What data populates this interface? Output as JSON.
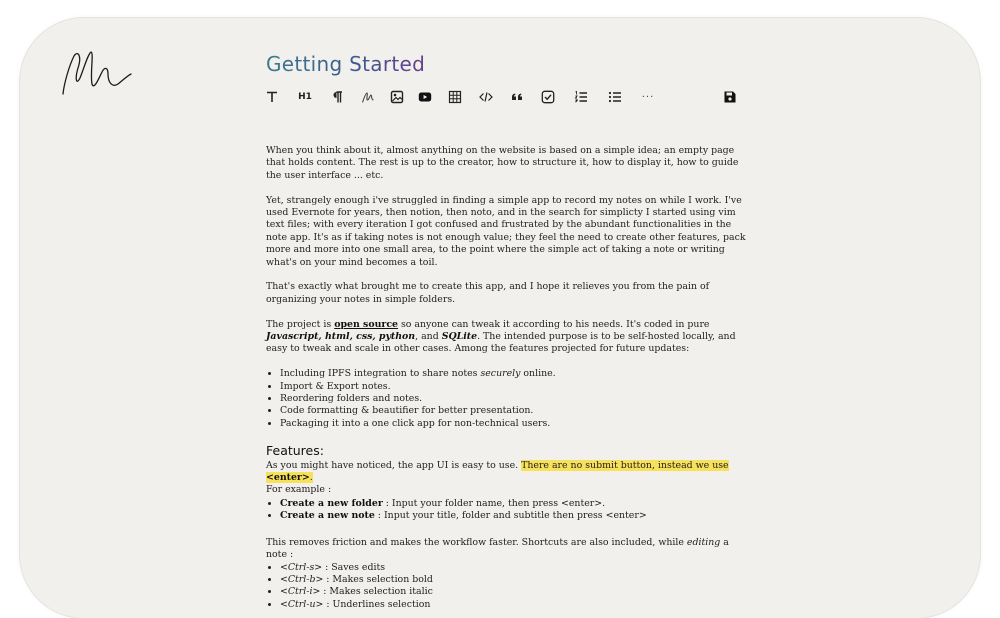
{
  "page": {
    "title": "Getting Started"
  },
  "toolbar": {
    "items": [
      {
        "name": "text-icon",
        "tooltip": ""
      },
      {
        "name": "heading-icon",
        "tooltip": ""
      },
      {
        "name": "paragraph-icon",
        "tooltip": ""
      },
      {
        "name": "signature-icon",
        "tooltip": ""
      },
      {
        "name": "image-icon",
        "tooltip": ""
      },
      {
        "name": "youtube-icon",
        "tooltip": ""
      },
      {
        "name": "table-icon",
        "tooltip": ""
      },
      {
        "name": "code-icon",
        "tooltip": ""
      },
      {
        "name": "quote-icon",
        "tooltip": ""
      },
      {
        "name": "checkbox-icon",
        "tooltip": ""
      },
      {
        "name": "ordered-list-icon",
        "tooltip": ""
      },
      {
        "name": "unordered-list-icon",
        "tooltip": ""
      },
      {
        "name": "more-icon",
        "tooltip": ""
      },
      {
        "name": "save-icon",
        "tooltip": ""
      }
    ],
    "heading_label": "H1",
    "more_label": "···"
  },
  "content": {
    "p1": "When you think about it, almost anything on the website is based on a simple idea; an empty page that holds content. The rest is up to the creator, how to structure it, how to display it, how to guide the user interface ... etc.",
    "p2": "Yet, strangely enough i've struggled in finding a simple app to record my notes on while I work. I've used Evernote for years, then notion, then noto, and in the search for simplicty I started using vim text files; with every iteration I got confused and frustrated by the abundant functionalities in the note app. It's as if taking notes is not enough value; they feel the need to create other features, pack more and more into one small area, to the point where the simple act of taking a note or writing what's on your mind becomes a toil.",
    "p3": "That's exactly what brought me to create this app, and I hope it relieves you from the pain of organizing your notes in simple folders.",
    "p4": {
      "t1": "The project is ",
      "link": "open source",
      "t2": " so anyone can tweak it according to his needs. It's coded in pure ",
      "js": "Javascript",
      "c1": ", ",
      "html": "html",
      "c2": ", ",
      "css": "css",
      "c3": ", ",
      "python": "python",
      "t3": ", and ",
      "sqlite": "SQLite",
      "t4": ". The intended purpose is to be self-hosted locally, and easy to tweak and scale in other cases. Among the features projected for future updates:"
    },
    "future": {
      "ipfs_pre": "Including IPFS integration to share notes ",
      "ipfs_em": "securely",
      "ipfs_post": " online.",
      "items": [
        "Import & Export notes.",
        "Reordering folders and notes.",
        "Code formatting & beautifier for better presentation.",
        "Packaging it into a one click app for non-technical users."
      ]
    },
    "features_heading": "Features:",
    "features_p": "As you might have noticed, the app UI is easy to use. ",
    "features_highlight_pre": "There are no submit button, instead we use ",
    "features_highlight_bold": "<enter>",
    "features_highlight_post": ".",
    "for_example": "For example :",
    "examples": [
      {
        "bold": "Create a new folder",
        "rest": " : Input your folder name, then press <enter>."
      },
      {
        "bold": "Create a new note",
        "rest": " : Input your title, folder and subtitle then press <enter>"
      }
    ],
    "shortcuts_pre": "This removes friction and makes the workflow faster. Shortcuts are also included, while ",
    "shortcuts_em": "editing",
    "shortcuts_post": " a note :",
    "shortcuts": [
      {
        "key": "<Ctrl-s>",
        "desc": " : Saves edits"
      },
      {
        "key": "<Ctrl-b>",
        "desc": " : Makes selection bold"
      },
      {
        "key": "<Ctrl-i>",
        "desc": "  : Makes selection italic"
      },
      {
        "key": "<Ctrl-u>",
        "desc": " : Underlines selection"
      }
    ]
  },
  "colors": {
    "frame": "#f1f0ec",
    "highlight": "#f7e15a",
    "title_gradient": [
      "#3b7a8f",
      "#6a3d8f"
    ]
  }
}
